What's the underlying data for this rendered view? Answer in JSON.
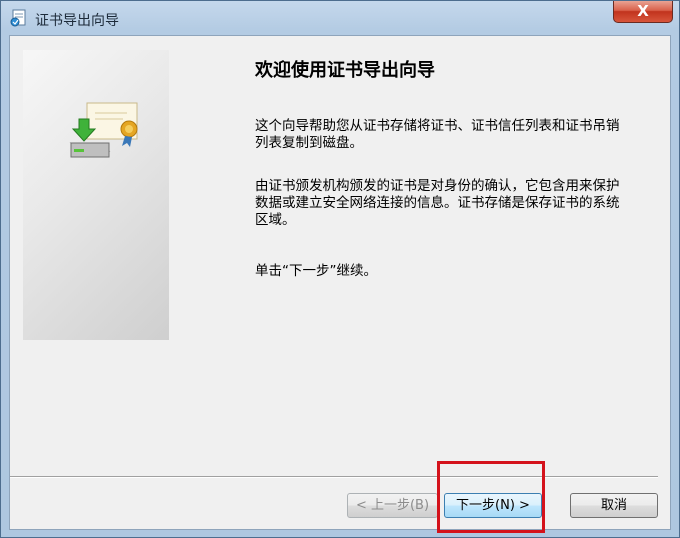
{
  "window": {
    "title": "证书导出向导",
    "close_label": "X"
  },
  "content": {
    "heading": "欢迎使用证书导出向导",
    "paragraph1": "这个向导帮助您从证书存储将证书、证书信任列表和证书吊销列表复制到磁盘。",
    "paragraph2": "由证书颁发机构颁发的证书是对身份的确认，它包含用来保护数据或建立安全网络连接的信息。证书存储是保存证书的系统区域。",
    "paragraph3": "单击“下一步”继续。"
  },
  "buttons": {
    "back": "< 上一步(B)",
    "next": "下一步(N) >",
    "cancel": "取消"
  },
  "icons": {
    "title": "certificate-window-icon",
    "panel": "certificate-export-icon"
  },
  "colors": {
    "highlight": "#d4121b",
    "close_button": "#c1331d"
  }
}
